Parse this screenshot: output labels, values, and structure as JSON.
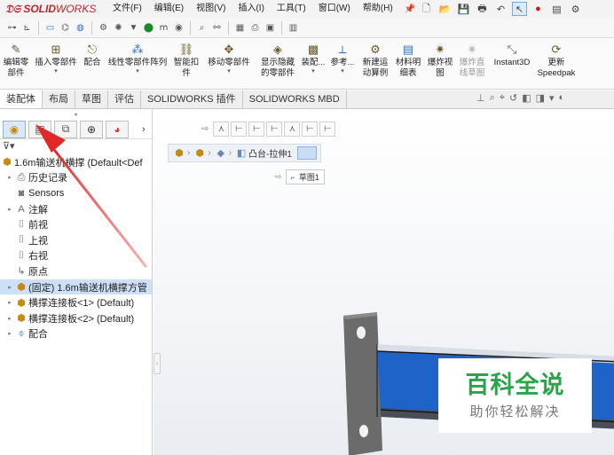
{
  "app": {
    "logo_text_a": "SOLID",
    "logo_text_b": "WORKS"
  },
  "menus": [
    "文件(F)",
    "编辑(E)",
    "视图(V)",
    "插入(I)",
    "工具(T)",
    "窗口(W)",
    "帮助(H)"
  ],
  "ribbon": {
    "items": [
      {
        "label": "编辑零\n部件",
        "icon": "edit-component-icon",
        "dropdown": false,
        "disabled": false
      },
      {
        "label": "插入零部件",
        "icon": "insert-component-icon",
        "dropdown": true,
        "disabled": false
      },
      {
        "label": "配合",
        "icon": "mate-icon",
        "dropdown": false,
        "disabled": false
      },
      {
        "label": "线性零部件阵列",
        "icon": "linear-pattern-icon",
        "dropdown": true,
        "disabled": false
      },
      {
        "label": "智能扣\n件",
        "icon": "smart-fastener-icon",
        "dropdown": false,
        "disabled": false
      },
      {
        "label": "移动零部件",
        "icon": "move-component-icon",
        "dropdown": true,
        "disabled": false
      },
      {
        "label": "显示隐藏\n的零部件",
        "icon": "show-hidden-icon",
        "dropdown": false,
        "disabled": false
      },
      {
        "label": "装配...",
        "icon": "assembly-feature-icon",
        "dropdown": true,
        "disabled": false
      },
      {
        "label": "参考...",
        "icon": "reference-geometry-icon",
        "dropdown": true,
        "disabled": false
      },
      {
        "label": "新建运\n动算例",
        "icon": "new-motion-study-icon",
        "dropdown": false,
        "disabled": false
      },
      {
        "label": "材料明\n细表",
        "icon": "bom-icon",
        "dropdown": false,
        "disabled": false
      },
      {
        "label": "爆炸视\n图",
        "icon": "exploded-view-icon",
        "dropdown": false,
        "disabled": false
      },
      {
        "label": "爆炸直\n线草图",
        "icon": "explode-line-sketch-icon",
        "dropdown": false,
        "disabled": true
      },
      {
        "label": "Instant3D",
        "icon": "instant3d-icon",
        "dropdown": false,
        "disabled": false
      },
      {
        "label": "更新\nSpeedpak",
        "icon": "update-speedpak-icon",
        "dropdown": false,
        "disabled": false
      }
    ]
  },
  "command_tabs": [
    "装配体",
    "布局",
    "草图",
    "评估",
    "SOLIDWORKS 插件",
    "SOLIDWORKS MBD"
  ],
  "active_command_tab": "装配体",
  "tree": {
    "root": "1.6m输送机横撑  (Default<Def",
    "items": [
      {
        "label": "历史记录",
        "icon": "history-icon",
        "expandable": true,
        "selected": false
      },
      {
        "label": "Sensors",
        "icon": "sensor-icon",
        "expandable": false,
        "selected": false
      },
      {
        "label": "注解",
        "icon": "annotation-icon",
        "expandable": true,
        "selected": false
      },
      {
        "label": "前视",
        "icon": "plane-icon",
        "expandable": false,
        "selected": false
      },
      {
        "label": "上视",
        "icon": "plane-icon",
        "expandable": false,
        "selected": false
      },
      {
        "label": "右视",
        "icon": "plane-icon",
        "expandable": false,
        "selected": false
      },
      {
        "label": "原点",
        "icon": "origin-icon",
        "expandable": false,
        "selected": false
      },
      {
        "label": "(固定) 1.6m输送机横撑方管",
        "icon": "part-icon",
        "expandable": true,
        "selected": true
      },
      {
        "label": "横撑连接板<1> (Default)",
        "icon": "part-icon",
        "expandable": true,
        "selected": false
      },
      {
        "label": "横撑连接板<2> (Default)",
        "icon": "part-icon",
        "expandable": true,
        "selected": false
      },
      {
        "label": "配合",
        "icon": "mates-folder-icon",
        "expandable": true,
        "selected": false
      }
    ]
  },
  "breadcrumb": {
    "feature_label": "凸台-拉伸1",
    "sketch_label": "草图1"
  },
  "watermark": {
    "title": "百科全说",
    "subtitle": "助你轻松解决"
  },
  "colors": {
    "logo": "#c8202a",
    "tube_blue": "#1f63c8",
    "watermark_green": "#2ba34a",
    "arrow_red": "#e03a3a",
    "selection": "#cde0f7"
  }
}
